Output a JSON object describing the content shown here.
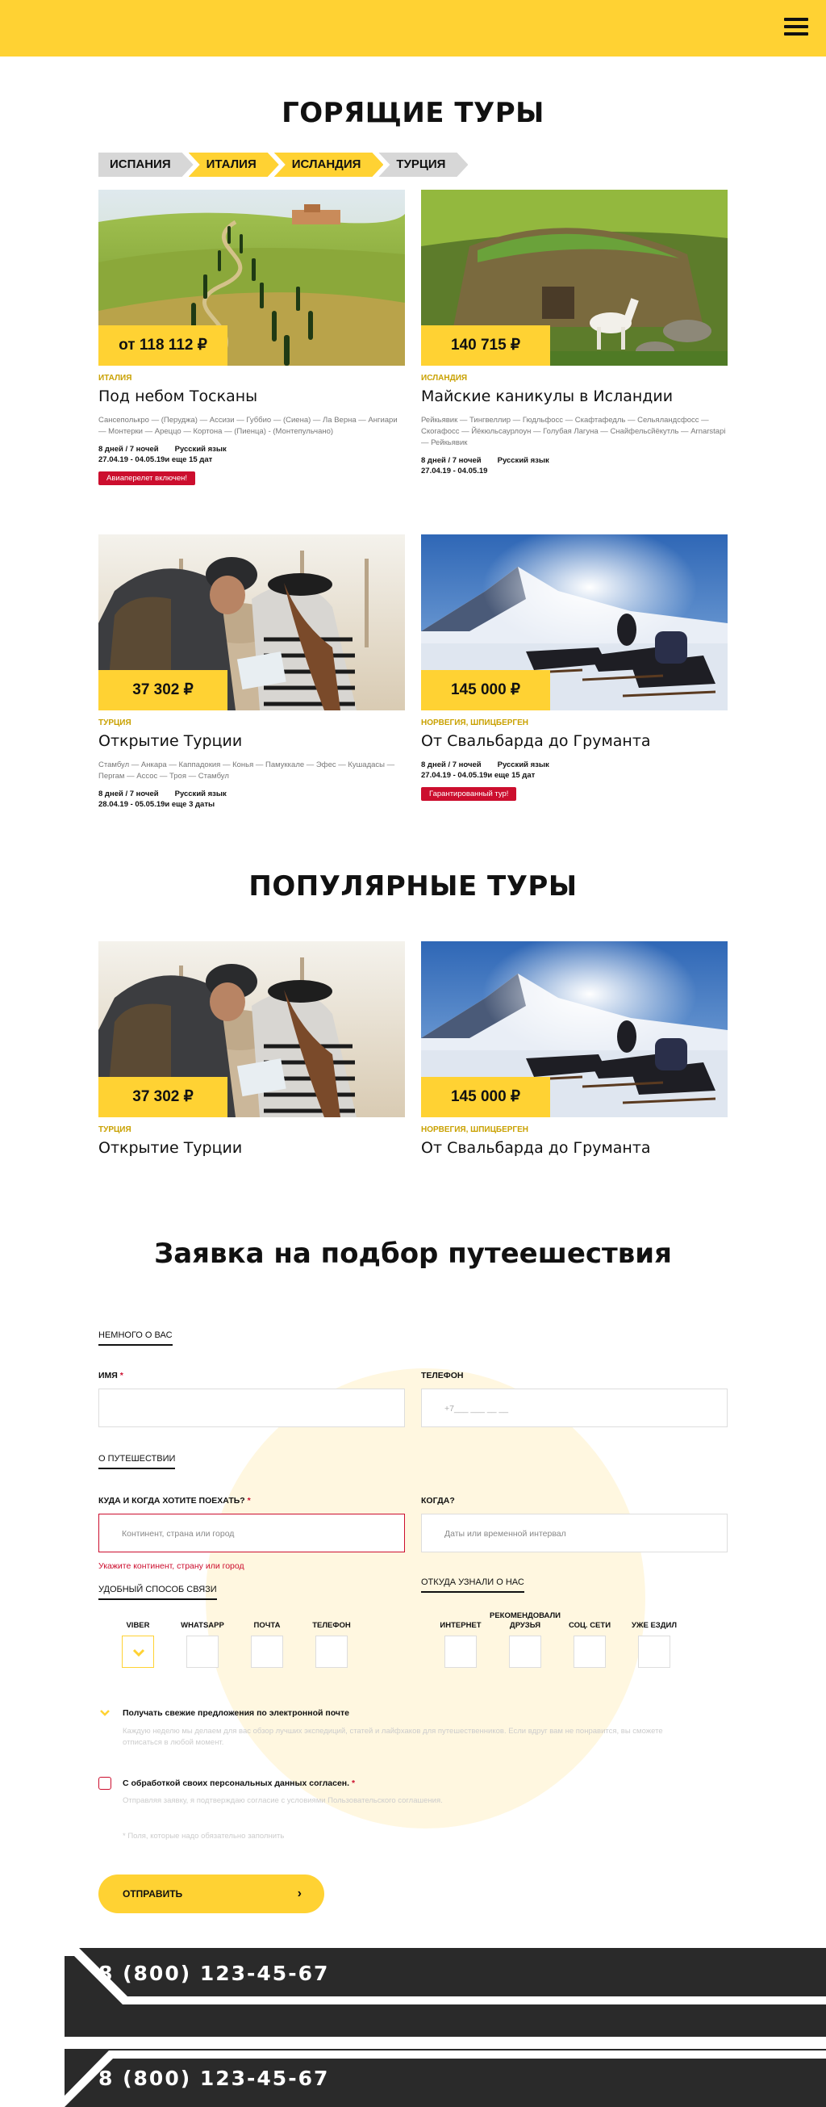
{
  "colors": {
    "accent": "#ffd233",
    "dark": "#2a2a2a",
    "error": "#cc0e2e"
  },
  "header": {
    "menu_icon": "burger-menu-icon"
  },
  "hot": {
    "title": "ГОРЯЩИЕ ТУРЫ",
    "tabs": [
      "ИСПАНИЯ",
      "ИТАЛИЯ",
      "ИСЛАНДИЯ",
      "ТУРЦИЯ"
    ],
    "cards": [
      {
        "price": "от 118 112 ₽",
        "country": "ИТАЛИЯ",
        "name": "Под небом Тосканы",
        "route": "Сансеполькро — (Перуджа) — Ассизи — Губбио — (Сиена) — Ла Верна — Ангиари — Монтерки — Ареццо — Кортона — (Пиенца) - (Монтепульчано)",
        "duration": "8 дней / 7 ночей",
        "language": "Русский язык",
        "dates": "27.04.19 - 04.05.19и еще 15 дат",
        "badge": "Авиаперелет включен!"
      },
      {
        "price": "140 715 ₽",
        "country": "ИСЛАНДИЯ",
        "name": "Майские каникулы в Исландии",
        "route": "Рейкьявик — Тингвеллир — Гюдльфосс — Скафтафедль — Сельяландсфосс — Скогафосс — Йёкюльсаурлоун — Голубая Лагуна — Снайфельсйёкутль — Arnarstapi — Рейкьявик",
        "duration": "8 дней / 7 ночей",
        "language": "Русский язык",
        "dates": "27.04.19 - 04.05.19"
      },
      {
        "price": "37 302 ₽",
        "country": "ТУРЦИЯ",
        "name": "Открытие Турции",
        "route": "Стамбул — Анкара — Каппадокия — Конья — Памуккале — Эфес — Кушадасы — Пергам — Ассос — Троя — Стамбул",
        "duration": "8 дней / 7 ночей",
        "language": "Русский язык",
        "dates": "28.04.19 - 05.05.19и еще 3 даты"
      },
      {
        "price": "145 000 ₽",
        "country": "НОРВЕГИЯ, ШПИЦБЕРГЕН",
        "name": "От Свальбарда до Груманта",
        "duration": "8 дней / 7 ночей",
        "language": "Русский язык",
        "dates": "27.04.19 - 04.05.19и еще 15 дат",
        "badge": "Гарантированный тур!"
      }
    ]
  },
  "popular": {
    "title": "ПОПУЛЯРНЫЕ ТУРЫ",
    "cards": [
      {
        "price": "37 302 ₽",
        "country": "ТУРЦИЯ",
        "name": "Открытие Турции"
      },
      {
        "price": "145 000 ₽",
        "country": "НОРВЕГИЯ, ШПИЦБЕРГЕН",
        "name": "От Свальбарда до Груманта"
      }
    ]
  },
  "form": {
    "title": "Заявка на подбор путеешествия",
    "about_label": "НЕМНОГО О ВАС",
    "name_label": "ИМЯ",
    "req_mark": "*",
    "phone_label": "ТЕЛЕФОН",
    "phone_placeholder": "+7___ ___ __ __",
    "trip_label": "О ПУТЕШЕСТВИИ",
    "where_label": "КУДА И КОГДА ХОТИТЕ ПОЕХАТЬ?",
    "where_placeholder": "Континент, страна или город",
    "when_label": "КОГДА?",
    "when_placeholder": "Даты или временной  интервал",
    "error_text": "Укажите континент, страну или город",
    "contact_label": "УДОБНЫЙ СПОСОБ СВЯЗИ",
    "source_label": "ОТКУДА УЗНАЛИ О НАС",
    "contact_options": [
      "VIBER",
      "WHATSAPP",
      "ПОЧТА",
      "ТЕЛЕФОН"
    ],
    "source_options": [
      "ИНТЕРНЕТ",
      "РЕКОМЕНДОВАЛИ ДРУЗЬЯ",
      "СОЦ. СЕТИ",
      "УЖЕ ЕЗДИЛ"
    ],
    "subscribe_text": "Получать свежие предложения по электронной почте",
    "subscribe_hint": "Каждую неделю мы делаем для вас обзор лучших экспедиций, статей и лайфхаков для путешественников. Если вдруг вам не понравится, вы сможете отписаться в любой момент.",
    "consent_text": "С обработкой своих персональных данных согласен.",
    "consent_hint": "Отправляя заявку, я подтверждаю согласие с условиями Пользовательского соглашения.",
    "required_note": "* Поля, которые надо обязательно заполнить",
    "submit_label": "ОТПРАВИТЬ",
    "submit_arrow": "›"
  },
  "footer": {
    "phone1": "8 (800) 123-45-67",
    "phone2": "8 (800) 123-45-67"
  }
}
